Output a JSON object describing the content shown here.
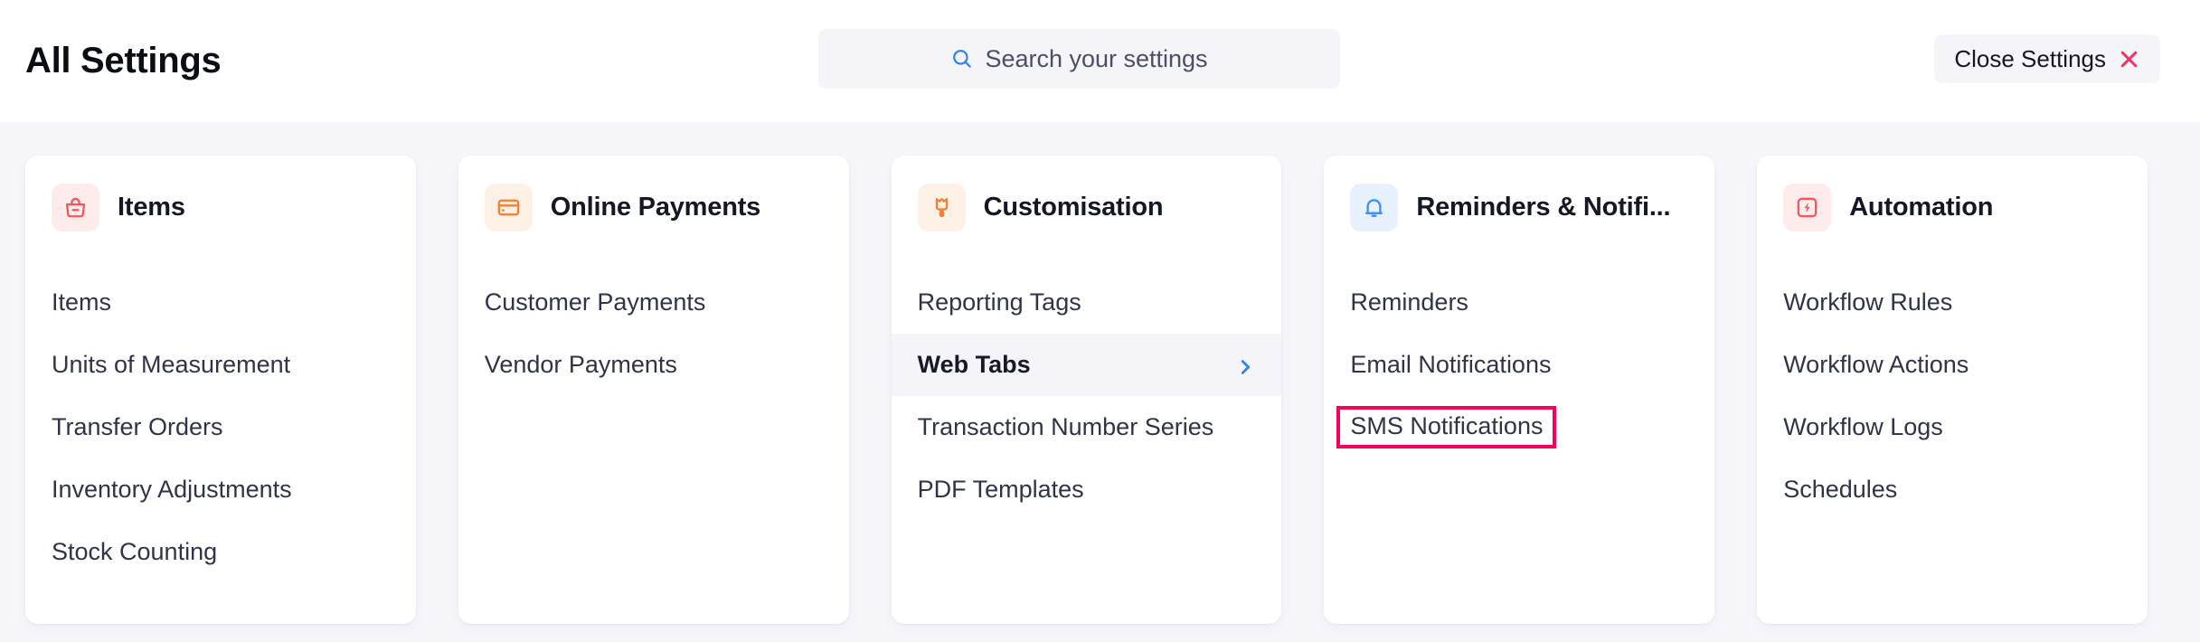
{
  "header": {
    "title": "All Settings",
    "search": {
      "placeholder": "Search your settings",
      "value": "",
      "icon": "search-icon"
    },
    "close_button": {
      "label": "Close Settings",
      "icon": "close-x-icon",
      "icon_color": "#f5315f"
    }
  },
  "colors": {
    "page_background": "#f6f6fb",
    "card_background": "#ffffff",
    "accent_blue": "#2f80ed",
    "highlight_outline": "#f5005c",
    "active_row_background": "#f4f4f9"
  },
  "cards": [
    {
      "title": "Items",
      "icon": "shopping-bag-icon",
      "icon_color": "#f4565a",
      "icon_background": "#fdeceb",
      "links": [
        {
          "label": "Items",
          "state": "normal"
        },
        {
          "label": "Units of Measurement",
          "state": "normal"
        },
        {
          "label": "Transfer Orders",
          "state": "normal"
        },
        {
          "label": "Inventory Adjustments",
          "state": "normal"
        },
        {
          "label": "Stock Counting",
          "state": "normal"
        }
      ]
    },
    {
      "title": "Online Payments",
      "icon": "credit-card-icon",
      "icon_color": "#f08033",
      "icon_background": "#fdf1e6",
      "links": [
        {
          "label": "Customer Payments",
          "state": "normal"
        },
        {
          "label": "Vendor Payments",
          "state": "normal"
        }
      ]
    },
    {
      "title": "Customisation",
      "icon": "paint-roller-icon",
      "icon_color": "#f08033",
      "icon_background": "#fdf1e6",
      "links": [
        {
          "label": "Reporting Tags",
          "state": "normal"
        },
        {
          "label": "Web Tabs",
          "state": "active",
          "chevron": "chevron-right-icon"
        },
        {
          "label": "Transaction Number Series",
          "state": "normal"
        },
        {
          "label": "PDF Templates",
          "state": "normal"
        }
      ]
    },
    {
      "title": "Reminders & Notifi...",
      "icon": "bell-icon",
      "icon_color": "#3f8cf4",
      "icon_background": "#e8f1fe",
      "links": [
        {
          "label": "Reminders",
          "state": "normal"
        },
        {
          "label": "Email Notifications",
          "state": "normal"
        },
        {
          "label": "SMS Notifications",
          "state": "highlighted"
        }
      ]
    },
    {
      "title": "Automation",
      "icon": "lightning-bolt-icon",
      "icon_color": "#f4565a",
      "icon_background": "#fdeceb",
      "links": [
        {
          "label": "Workflow Rules",
          "state": "normal"
        },
        {
          "label": "Workflow Actions",
          "state": "normal"
        },
        {
          "label": "Workflow Logs",
          "state": "normal"
        },
        {
          "label": "Schedules",
          "state": "normal"
        }
      ]
    }
  ]
}
